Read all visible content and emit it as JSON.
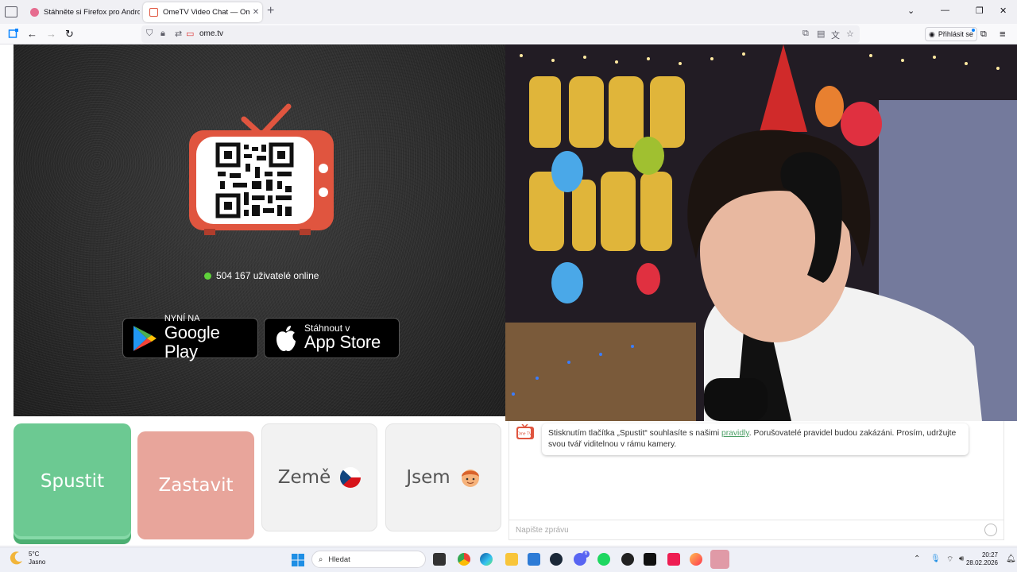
{
  "browser": {
    "tabs": [
      {
        "title": "Stáhněte si Firefox pro Android",
        "active": false,
        "favicon_color": "#e66c8f"
      },
      {
        "title": "OmeTV Video Chat — Omegle",
        "active": true,
        "favicon_color": "#e0553f"
      }
    ],
    "new_tab_label": "+",
    "url": "ome.tv",
    "signin_label": "Přihlásit se",
    "window_controls": {
      "list": "⌄",
      "minimize": "—",
      "restore": "❐",
      "close": "✕"
    },
    "nav": {
      "back": "←",
      "forward": "→",
      "reload": "↻"
    }
  },
  "page": {
    "online_count_text": "504 167 uživatelé online",
    "google_play": {
      "small": "NYNÍ NA",
      "big": "Google Play"
    },
    "app_store": {
      "small": "Stáhnout v",
      "big": "App Store"
    },
    "buttons": {
      "start": "Spustit",
      "stop": "Zastavit",
      "country": "Země",
      "gender": "Jsem"
    },
    "chat": {
      "message_before": "Stisknutím tlačítka „Spustit“ souhlasíte s našimi ",
      "message_link": "pravidly",
      "message_after": ". Porušovatelé pravidel budou zakázáni. Prosím, udržujte svou tvář viditelnou v rámu kamery.",
      "input_placeholder": "Napište zprávu",
      "logo_text": "Ome TV"
    }
  },
  "taskbar": {
    "weather_temp": "5°C",
    "weather_desc": "Jasno",
    "search_placeholder": "Hledat",
    "time": "20:27",
    "date": "28.02.2026",
    "discord_badge": "6"
  }
}
